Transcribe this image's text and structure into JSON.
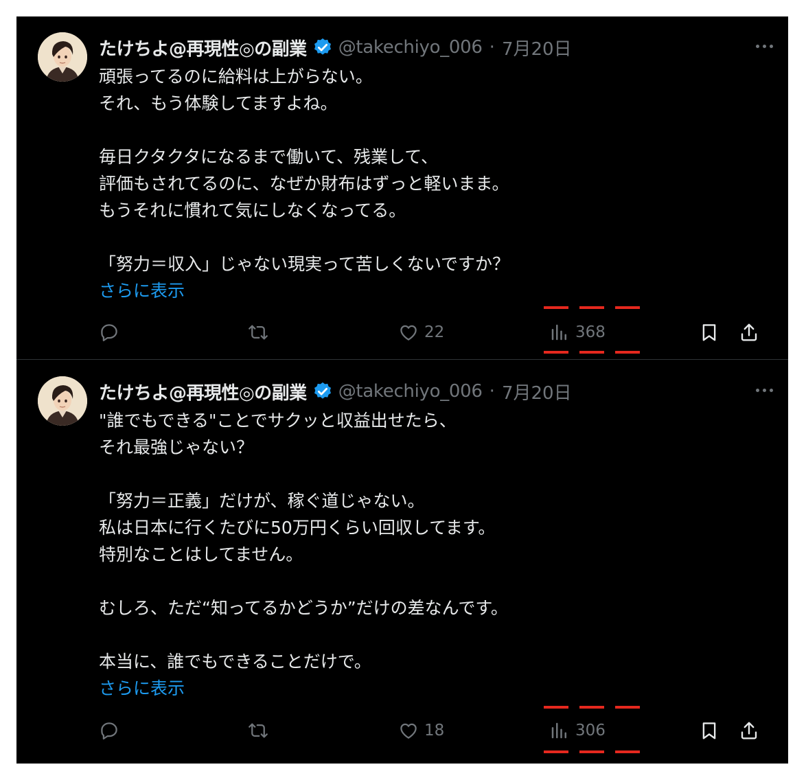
{
  "posts": [
    {
      "author": "たけちよ@再現性◎の副業",
      "handle": "@takechiyo_006",
      "separator": "·",
      "date": "7月20日",
      "lines": [
        "頑張ってるのに給料は上がらない。",
        "それ、もう体験してますよね。",
        "",
        "毎日クタクタになるまで働いて、残業して、",
        "評価もされてるのに、なぜか財布はずっと軽いまま。",
        "もうそれに慣れて気にしなくなってる。",
        "",
        "「努力＝収入」じゃない現実って苦しくないですか？"
      ],
      "show_more": "さらに表示",
      "likes": "22",
      "views": "368"
    },
    {
      "author": "たけちよ@再現性◎の副業",
      "handle": "@takechiyo_006",
      "separator": "·",
      "date": "7月20日",
      "lines": [
        "\"誰でもできる\"ことでサクッと収益出せたら、",
        "それ最強じゃない？",
        "",
        "「努力＝正義」だけが、稼ぐ道じゃない。",
        "私は日本に行くたびに50万円くらい回収してます。",
        "特別なことはしてません。",
        "",
        "むしろ、ただ“知ってるかどうか”だけの差なんです。",
        "",
        "本当に、誰でもできることだけで。"
      ],
      "show_more": "さらに表示",
      "likes": "18",
      "views": "306"
    }
  ],
  "colors": {
    "background": "#000000",
    "text": "#e7e9ea",
    "muted": "#71767b",
    "link": "#1d9bf0",
    "verified": "#1d9bf0",
    "annotation": "#e5281e"
  },
  "icons": [
    "reply-icon",
    "retweet-icon",
    "like-icon",
    "views-icon",
    "bookmark-icon",
    "share-icon",
    "more-icon",
    "verified-icon"
  ]
}
